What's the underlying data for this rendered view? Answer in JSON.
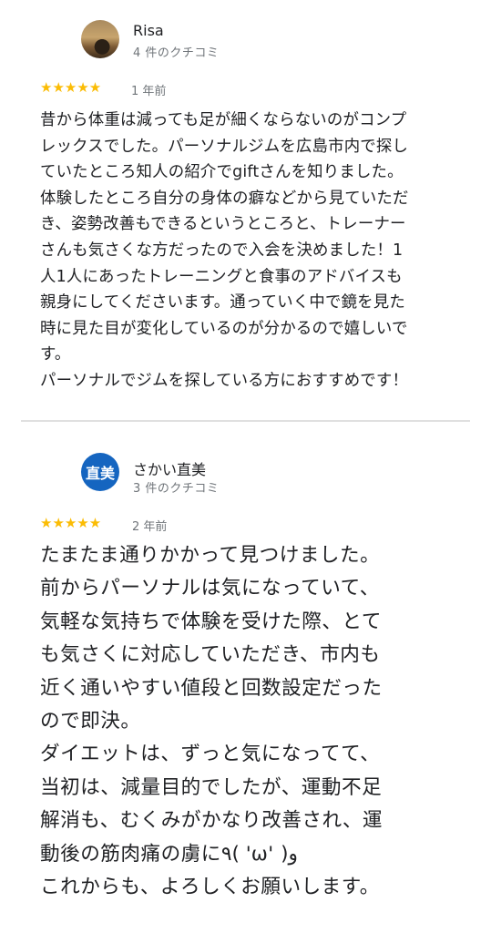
{
  "reviews": [
    {
      "name": "Risa",
      "review_count": "4 件のクチコミ",
      "stars": "★★★★★",
      "rating": 5,
      "date": "1 年前",
      "text": "昔から体重は減っても足が細くならないのがコンプ\nレックスでした。パーソナルジムを広島市内で探し\nていたところ知人の紹介でgiftさんを知りました。\n体験したところ自分の身体の癖などから見ていただ\nき、姿勢改善もできるというところと、トレーナー\nさんも気さくな方だったので入会を決めました！1\n人1人にあったトレーニングと食事のアドバイスも\n親身にしてくださいます。通っていく中で鏡を見た\n時に見た目が変化しているのが分かるので嬉しいで\nす。\nパーソナルでジムを探している方におすすめです！"
    },
    {
      "name": "さかい直美",
      "avatar_initials": "直美",
      "review_count": "3 件のクチコミ",
      "stars": "★★★★★",
      "rating": 5,
      "date": "2 年前",
      "text": "たまたま通りかかって見つけました。\n前からパーソナルは気になっていて、\n気軽な気持ちで体験を受けた際、とて\nも気さくに対応していただき、市内も\n近く通いやすい値段と回数設定だった\nので即決。\nダイエットは、ずっと気になってて、\n当初は、減量目的でしたが、運動不足\n解消も、むくみがかなり改善され、運\n動後の筋肉痛の虜に٩( 'ω' )و\nこれからも、よろしくお願いします。"
    }
  ],
  "colors": {
    "star": "#fbbc04",
    "avatar_bg": "#1565c0",
    "secondary_text": "#70757a",
    "divider": "#e0e0e0"
  }
}
